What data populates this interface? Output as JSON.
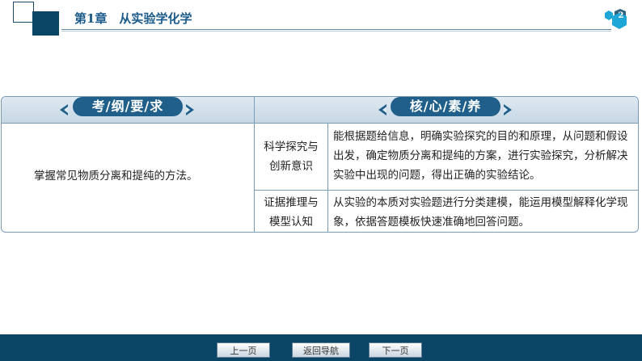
{
  "header": {
    "chapter_title": "第1章　从实验学化学",
    "page_number": "2"
  },
  "table": {
    "col1_header": "考/纲/要/求",
    "col2_header": "核/心/素/养",
    "requirement": "掌握常见物质分离和提纯的方法。",
    "rows": [
      {
        "label_line1": "科学探究与",
        "label_line2": "创新意识",
        "desc_line1": "能根据题给信息，明确实验探究的目的和原理，从问题和假设",
        "desc_line2": "出发，确定物质分离和提纯的方案，进行实验探究，分析解决",
        "desc_line3": "实验中出现的问题，得出正确的实验结论。"
      },
      {
        "label_line1": "证据推理与",
        "label_line2": "模型认知",
        "desc_line1": "从实验的本质对实验题进行分类建模，能运用模型解释化学现",
        "desc_line2": "象，依据答题模板快速准确地回答问题。"
      }
    ]
  },
  "nav": {
    "prev": "上一页",
    "home": "返回导航",
    "next": "下一页"
  },
  "colors": {
    "brand_dark": "#0b4566",
    "header_blue": "#1f5f8a",
    "page_badge": "#1da6d6"
  }
}
